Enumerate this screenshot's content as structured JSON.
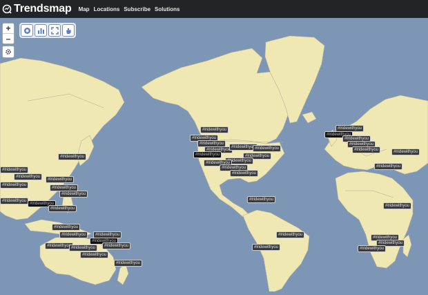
{
  "app": {
    "name": "Trendsmap",
    "nav": [
      "Map",
      "Locations",
      "Subscribe",
      "Solutions"
    ]
  },
  "controls": {
    "zoom_in": "+",
    "zoom_out": "–"
  },
  "map": {
    "ocean_color": "#7e96b6",
    "land_color": "#efe8b3",
    "border_color": "#a8a8a8"
  },
  "hashtag": "#lridewithyou",
  "tags": [
    "#lridewithyou",
    "#lridewithyou",
    "#lridewithyou",
    "#lridewithyou",
    "#lridewithyou",
    "#lridewithyou",
    "#lridewithyou",
    "#lridewithyou",
    "#lridewithyou",
    "#lridewithyou",
    "#lridewithyou",
    "#lridewithyou",
    "#lridewithyou",
    "#lridewithyou",
    "#lridewithyou",
    "#lridewithyou",
    "#lridewithyou",
    "#lridewithyou",
    "#lridewithyou",
    "#lridewithyou",
    "#lridewithyou",
    "#lridewithyou",
    "#lridewithyou",
    "#lridewithyou",
    "#lridewithyou",
    "#lridewithyou",
    "#lridewithyou",
    "#lridewithyou",
    "#lridewithyou",
    "#lridewithyou",
    "#lridewithyou",
    "#lridewithyou",
    "#lridewithyou",
    "#lridewithyou",
    "#lridewithyou",
    "#lridewithyou",
    "#lridewithyou",
    "#lridewithyou",
    "#lridewithyou",
    "#lridewithyou",
    "#lridewithyou",
    "#lridewithyou",
    "#lridewithyou",
    "#lridewithyou",
    "#lridewithyou"
  ]
}
